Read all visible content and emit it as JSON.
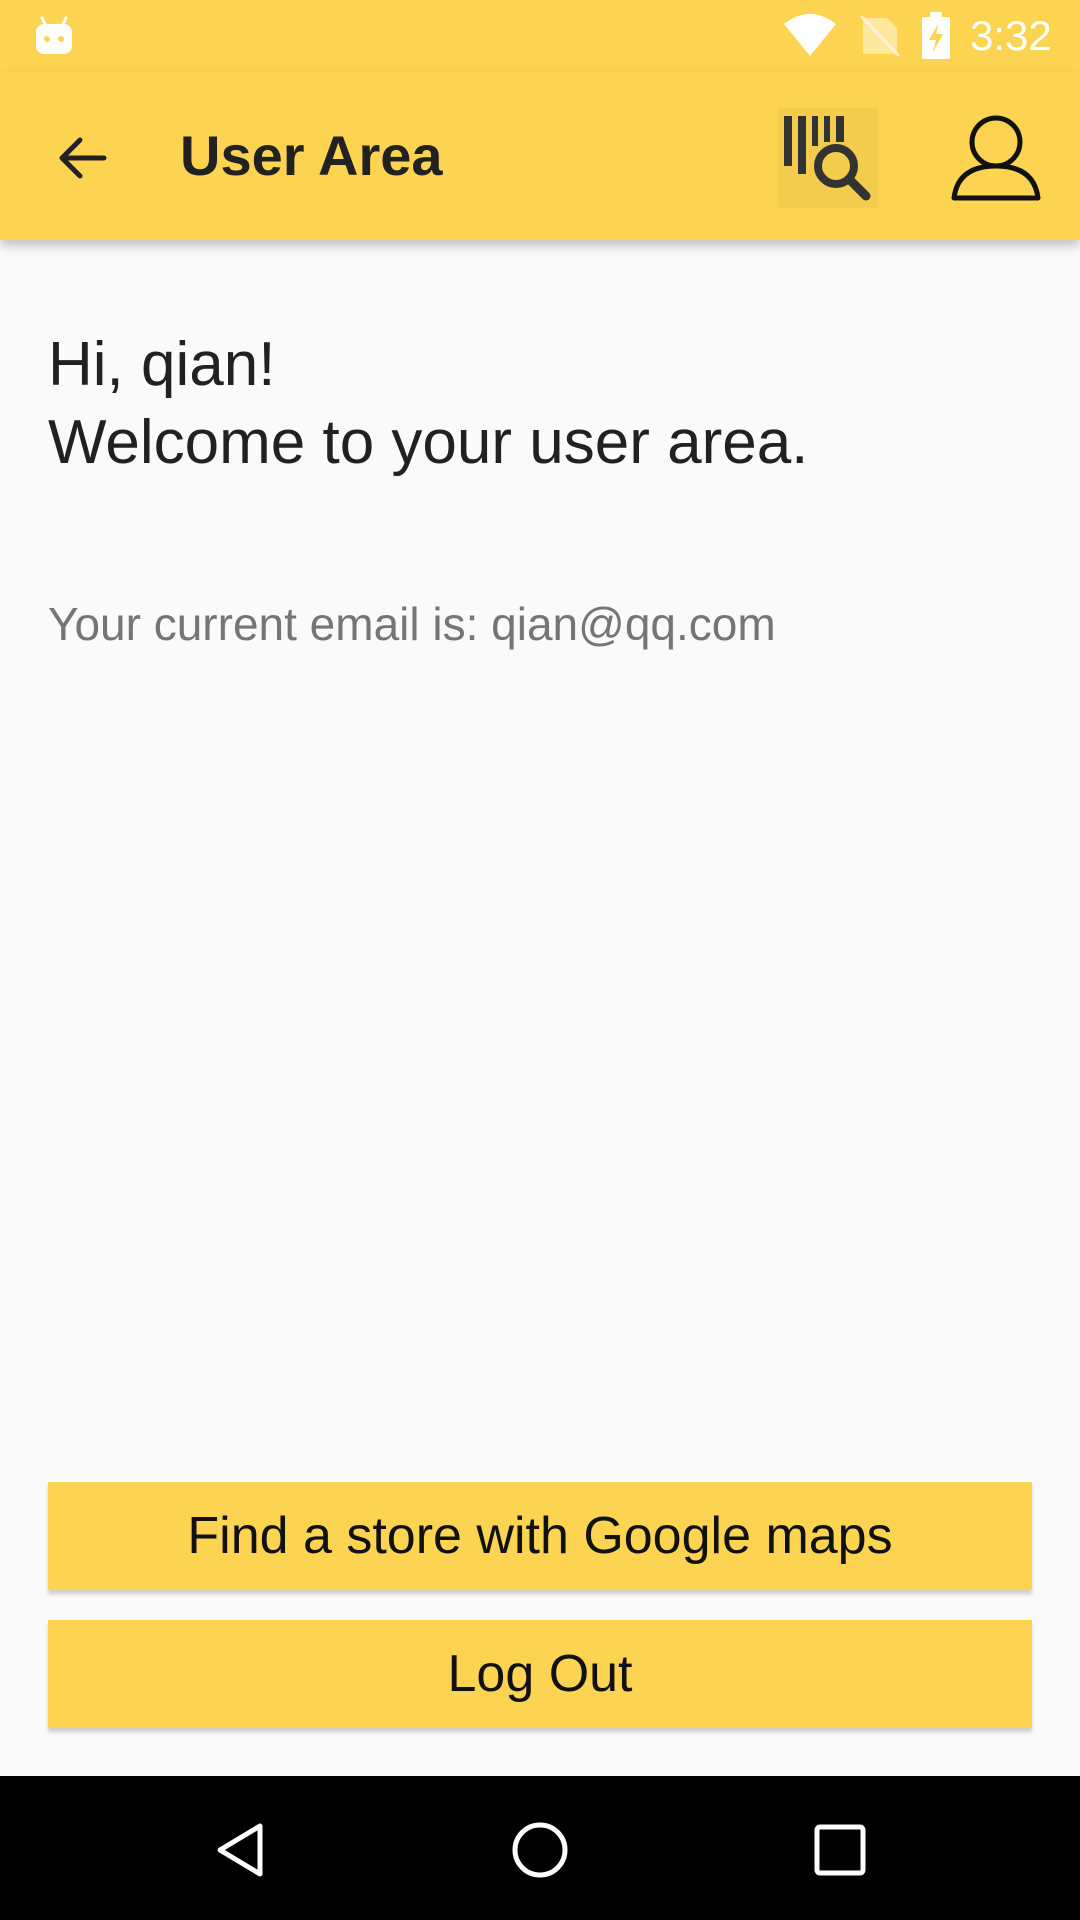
{
  "status_bar": {
    "time": "3:32",
    "icons": [
      "android-icon",
      "wifi-icon",
      "no-sim-icon",
      "battery-charging-icon"
    ]
  },
  "app_bar": {
    "title": "User Area",
    "back_icon": "arrow-back-icon",
    "scan_icon": "barcode-search-icon",
    "user_icon": "user-icon",
    "color": "#FDD451"
  },
  "content": {
    "greeting_line1": "Hi, qian!",
    "greeting_line2": "Welcome to your user area.",
    "email_text": "Your current email is: qian@qq.com"
  },
  "buttons": {
    "find_store_label": "Find a store with Google maps",
    "logout_label": "Log Out"
  },
  "nav_bar": {
    "icons": [
      "nav-back-icon",
      "nav-home-icon",
      "nav-recents-icon"
    ]
  },
  "colors": {
    "accent": "#FDD451",
    "background": "#FAFAFA",
    "primary_text": "#212121",
    "secondary_text": "#757575"
  }
}
